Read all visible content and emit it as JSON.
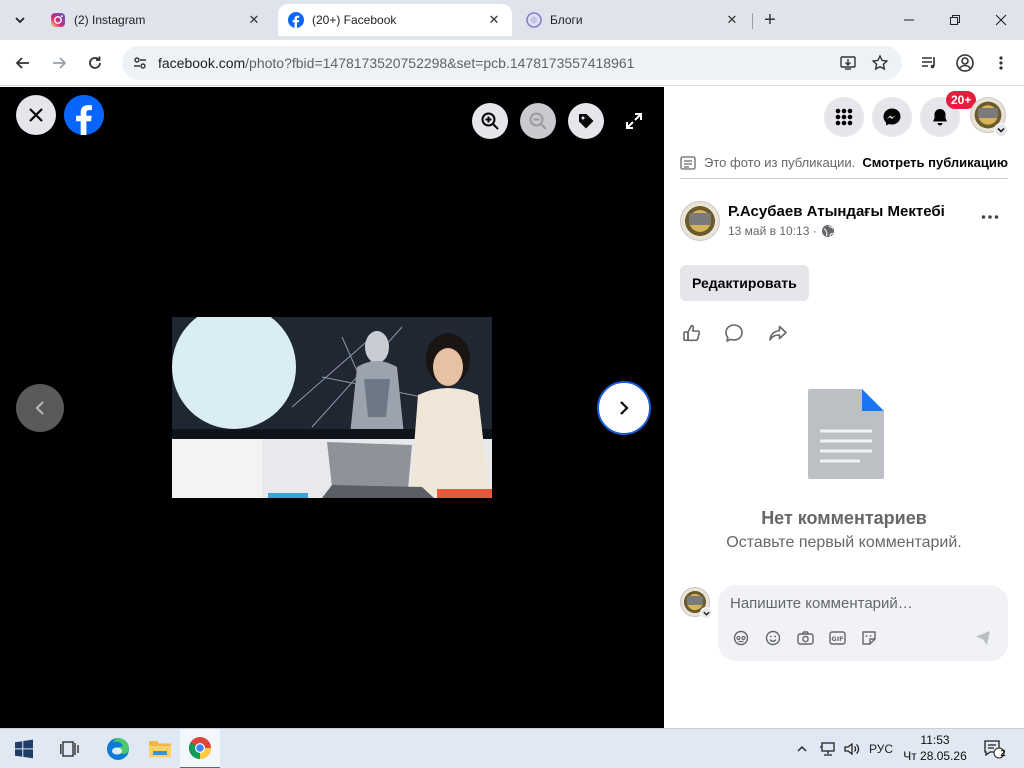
{
  "tabs": [
    {
      "title": "(2) Instagram",
      "active": false
    },
    {
      "title": "(20+) Facebook",
      "active": true
    },
    {
      "title": "Блоги",
      "active": false
    }
  ],
  "address_bar": {
    "url_host": "facebook.com",
    "url_path": "/photo?fbid=1478173520752298&set=pcb.1478173557418961"
  },
  "header": {
    "notification_badge": "20+"
  },
  "post": {
    "info_text": "Это фото из публикации.",
    "see_post_link": "Смотреть публикацию",
    "author": "Р.Асубаев Атындағы Мектебі",
    "time": "13 май в 10:13 ·",
    "edit_button": "Редактировать"
  },
  "comments": {
    "empty_title": "Нет комментариев",
    "empty_subtitle": "Оставьте первый комментарий.",
    "input_placeholder": "Напишите комментарий…"
  },
  "taskbar": {
    "language": "РУС",
    "time": "11:53",
    "date": "Чт 28.05.26",
    "notifications_count": "2"
  },
  "colors": {
    "facebook_blue": "#0866ff",
    "viewer_background": "#000000",
    "badge_red": "#e41e3f",
    "muted_text": "#65676b"
  }
}
